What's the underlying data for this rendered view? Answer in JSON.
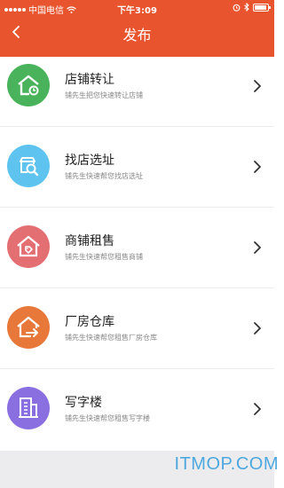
{
  "status_bar": {
    "carrier": "中国电信",
    "time": "下午3:09"
  },
  "nav": {
    "title": "发布"
  },
  "items": [
    {
      "title": "店铺转让",
      "subtitle": "铺先生把您快速转让店铺",
      "color": "#48b35a",
      "icon": "store-transfer-icon"
    },
    {
      "title": "找店选址",
      "subtitle": "铺先生快速帮您找店选址",
      "color": "#5fc3ef",
      "icon": "store-search-icon"
    },
    {
      "title": "商铺租售",
      "subtitle": "铺先生快速帮您租售商铺",
      "color": "#e46f73",
      "icon": "house-tag-icon"
    },
    {
      "title": "厂房仓库",
      "subtitle": "铺先生快速帮您租售厂房仓库",
      "color": "#e8773a",
      "icon": "warehouse-icon"
    },
    {
      "title": "写字楼",
      "subtitle": "铺先生快速帮您租售写字楼",
      "color": "#8a6fe0",
      "icon": "office-building-icon"
    }
  ],
  "watermark": "ITMOP.COM"
}
